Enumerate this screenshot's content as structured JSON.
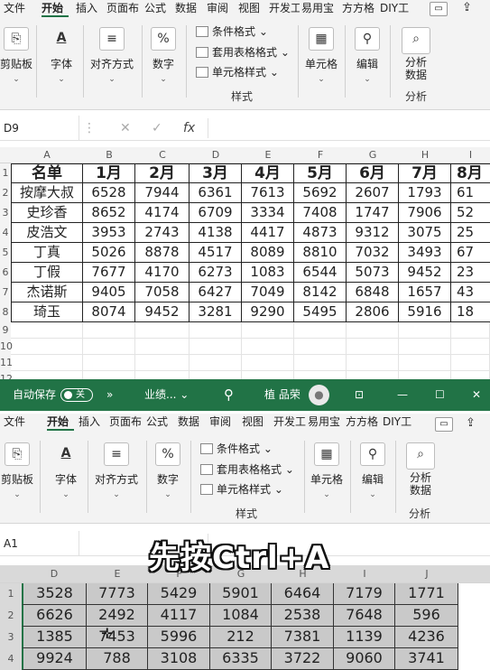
{
  "top": {
    "tabs": [
      "文件",
      "开始",
      "插入",
      "页面布",
      "公式",
      "数据",
      "审阅",
      "视图",
      "开发工",
      "易用宝",
      "方方格",
      "DIY工"
    ],
    "active_tab": "开始",
    "ribbon": {
      "clipboard": "剪贴板",
      "font": "字体",
      "align": "对齐方式",
      "number": "数字",
      "cond_format": "条件格式 ⌄",
      "table_format": "套用表格格式 ⌄",
      "cell_style": "单元格样式 ⌄",
      "styles_group": "样式",
      "cells": "单元格",
      "edit": "编辑",
      "analyze_l1": "分析",
      "analyze_l2": "数据",
      "analyze_group": "分析"
    },
    "name_box": "D9",
    "columns": [
      "A",
      "B",
      "C",
      "D",
      "E",
      "F",
      "G",
      "H",
      "I"
    ],
    "rows": [
      "1",
      "2",
      "3",
      "4",
      "5",
      "6",
      "7",
      "8",
      "9",
      "10",
      "11",
      "12"
    ],
    "table": {
      "header": [
        "名单",
        "1月",
        "2月",
        "3月",
        "4月",
        "5月",
        "6月",
        "7月",
        "8月"
      ],
      "rows": [
        [
          "按摩大叔",
          "6528",
          "7944",
          "6361",
          "7613",
          "5692",
          "2607",
          "1793",
          "61"
        ],
        [
          "史珍香",
          "8652",
          "4174",
          "6709",
          "3334",
          "7408",
          "1747",
          "7906",
          "52"
        ],
        [
          "皮浩文",
          "3953",
          "2743",
          "4138",
          "4417",
          "4873",
          "9312",
          "3075",
          "25"
        ],
        [
          "丁真",
          "5026",
          "8878",
          "4517",
          "8089",
          "8810",
          "7032",
          "3493",
          "67"
        ],
        [
          "丁假",
          "7677",
          "4170",
          "6273",
          "1083",
          "6544",
          "5073",
          "9452",
          "23"
        ],
        [
          "杰诺斯",
          "9405",
          "7058",
          "6427",
          "7049",
          "8142",
          "6848",
          "1657",
          "43"
        ],
        [
          "琦玉",
          "8074",
          "9452",
          "3281",
          "9290",
          "5495",
          "2806",
          "5916",
          "18"
        ]
      ]
    }
  },
  "bottom": {
    "autosave": "自动保存",
    "toggle": "关",
    "more": "»",
    "filename": "业绩... ⌄",
    "user": "植 品荣",
    "tabs": [
      "文件",
      "开始",
      "插入",
      "页面布",
      "公式",
      "数据",
      "审阅",
      "视图",
      "开发工",
      "易用宝",
      "方方格",
      "DIY工"
    ],
    "active_tab": "开始",
    "ribbon": {
      "clipboard": "剪贴板",
      "font": "字体",
      "align": "对齐方式",
      "number": "数字",
      "cond_format": "条件格式 ⌄",
      "table_format": "套用表格格式 ⌄",
      "cell_style": "单元格样式 ⌄",
      "styles_group": "样式",
      "cells": "单元格",
      "edit": "编辑",
      "analyze_l1": "分析",
      "analyze_l2": "数据",
      "analyze_group": "分析"
    },
    "name_box": "A1",
    "overlay_text": "先按Ctrl+A",
    "columns": [
      "D",
      "E",
      "F",
      "G",
      "H",
      "I",
      "J"
    ],
    "rows": [
      "1",
      "2",
      "3",
      "4"
    ],
    "values": [
      [
        "3528",
        "7773",
        "5429",
        "5901",
        "6464",
        "7179",
        "1771"
      ],
      [
        "6626",
        "2492",
        "4117",
        "1084",
        "2538",
        "7648",
        "596"
      ],
      [
        "1385",
        "7453",
        "5996",
        "212",
        "7381",
        "1139",
        "4236"
      ],
      [
        "9924",
        "788",
        "3108",
        "6335",
        "3722",
        "9060",
        "3741"
      ]
    ]
  },
  "colors": {
    "excel_green": "#217346",
    "selection": "#c9c9c9",
    "ribbon_bg": "#f3f3f3"
  }
}
